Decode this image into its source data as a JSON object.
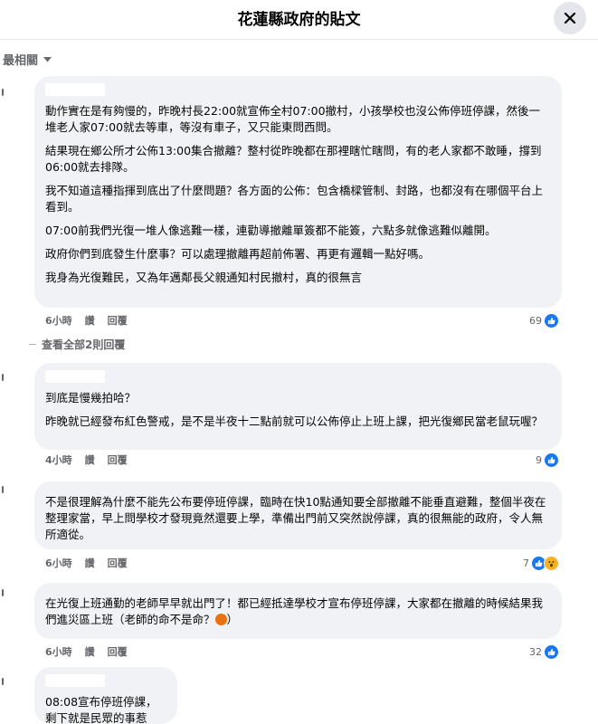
{
  "header": {
    "title": "花蓮縣政府的貼文"
  },
  "sort": {
    "label": "最相關"
  },
  "comments": [
    {
      "paragraphs": [
        "動作實在是有夠慢的，昨晚村長22:00就宣佈全村07:00撤村，小孩學校也沒公佈停班停課，然後一堆老人家07:00就去等車，等沒有車子，又只能東問西問。",
        "結果現在鄉公所才公佈13:00集合撤離？整村從昨晚都在那裡瞎忙瞎問，有的老人家都不敢睡，撐到06:00就去排隊。",
        "我不知道這種指揮到底出了什麼問題？各方面的公佈：包含橋樑管制、封路，也都沒有在哪個平台上看到。",
        "07:00前我們光復一堆人像逃難一樣，連勸導撤離單簽都不能簽，六點多就像逃難似離開。",
        "政府你們到底發生什麼事？可以處理撤離再超前佈署、再更有邏輯一點好嗎。",
        "我身為光復難民，又為年邁鄰長父親通知村民撤村，真的很無言"
      ],
      "time": "6小時",
      "like": "讚",
      "reply": "回覆",
      "reactions": "69",
      "view_replies": "查看全部2則回覆"
    },
    {
      "paragraphs": [
        "到底是慢幾拍哈？",
        "昨晚就已經發布紅色警戒，是不是半夜十二點前就可以公佈停止上班上課，把光復鄉民當老鼠玩喔？"
      ],
      "time": "4小時",
      "like": "讚",
      "reply": "回覆",
      "reactions": "9"
    },
    {
      "paragraphs": [
        "不是很理解為什麼不能先公布要停班停課，臨時在快10點通知要全部撤離不能垂直避難，整個半夜在整理家當，早上問學校才發現竟然還要上學，準備出門前又突然說停課，真的很無能的政府，令人無所適從。"
      ],
      "time": "6小時",
      "like": "讚",
      "reply": "回覆",
      "reactions": "7"
    },
    {
      "paragraphs": [
        "在光復上班通勤的老師早早就出門了！都已經抵達學校才宣布停班停課，大家都在撤離的時候結果我們進災區上班（老師的命不是命？"
      ],
      "paragraph_tail": "）",
      "time": "6小時",
      "like": "讚",
      "reply": "回覆",
      "reactions": "32"
    },
    {
      "paragraphs": [
        "08:08宣布停班停課，",
        "剩下就是民眾的事惹"
      ]
    }
  ]
}
